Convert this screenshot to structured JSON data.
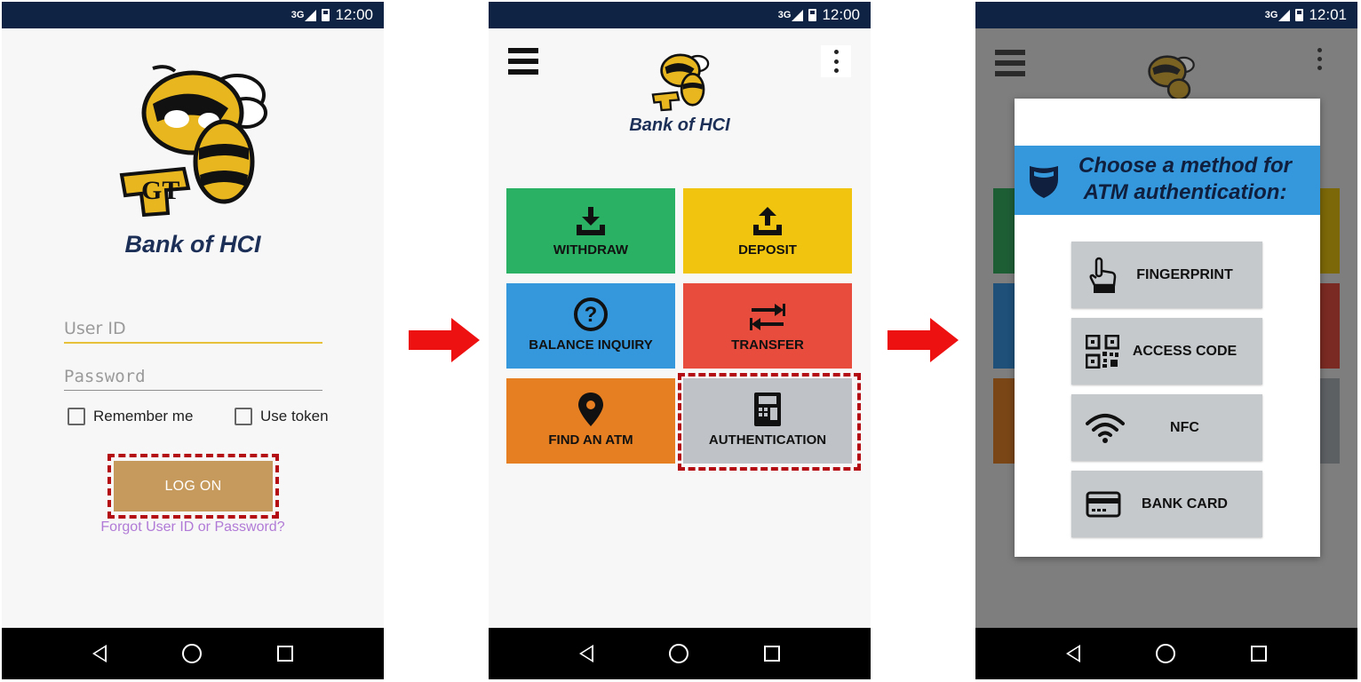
{
  "colors": {
    "status_bar": "#0f2344",
    "brand_text": "#1c2f57",
    "logon_button": "#c59a5c",
    "highlight_frame": "#b40e14",
    "withdraw": "#2ab163",
    "deposit": "#f1c40f",
    "balance": "#3598dc",
    "transfer": "#e74c3c",
    "find_atm": "#e67f22",
    "authentication": "#bfc3c7",
    "forgot_link": "#b17ad6"
  },
  "screens": [
    {
      "status": {
        "network": "3G",
        "time": "12:00"
      },
      "brand": "Bank of HCI",
      "login": {
        "user_id_placeholder": "User ID",
        "password_placeholder": "Password",
        "remember_label": "Remember me",
        "token_label": "Use token",
        "logon_label": "LOG ON",
        "forgot_link": "Forgot User ID or Password?"
      }
    },
    {
      "status": {
        "network": "3G",
        "time": "12:00"
      },
      "brand": "Bank of HCI",
      "tiles": {
        "withdraw": "WITHDRAW",
        "deposit": "DEPOSIT",
        "balance": "BALANCE INQUIRY",
        "transfer": "TRANSFER",
        "find_atm": "FIND AN ATM",
        "authentication": "AUTHENTICATION"
      }
    },
    {
      "status": {
        "network": "3G",
        "time": "12:01"
      },
      "dialog": {
        "title": "Choose a method for ATM authentication:",
        "options": [
          "FINGERPRINT",
          "ACCESS CODE",
          "NFC",
          "BANK CARD"
        ]
      }
    }
  ],
  "icons": {
    "flow_arrow": "right-arrow-icon",
    "mascot": "yellow-jacket-logo",
    "logo_letters": "GT"
  }
}
